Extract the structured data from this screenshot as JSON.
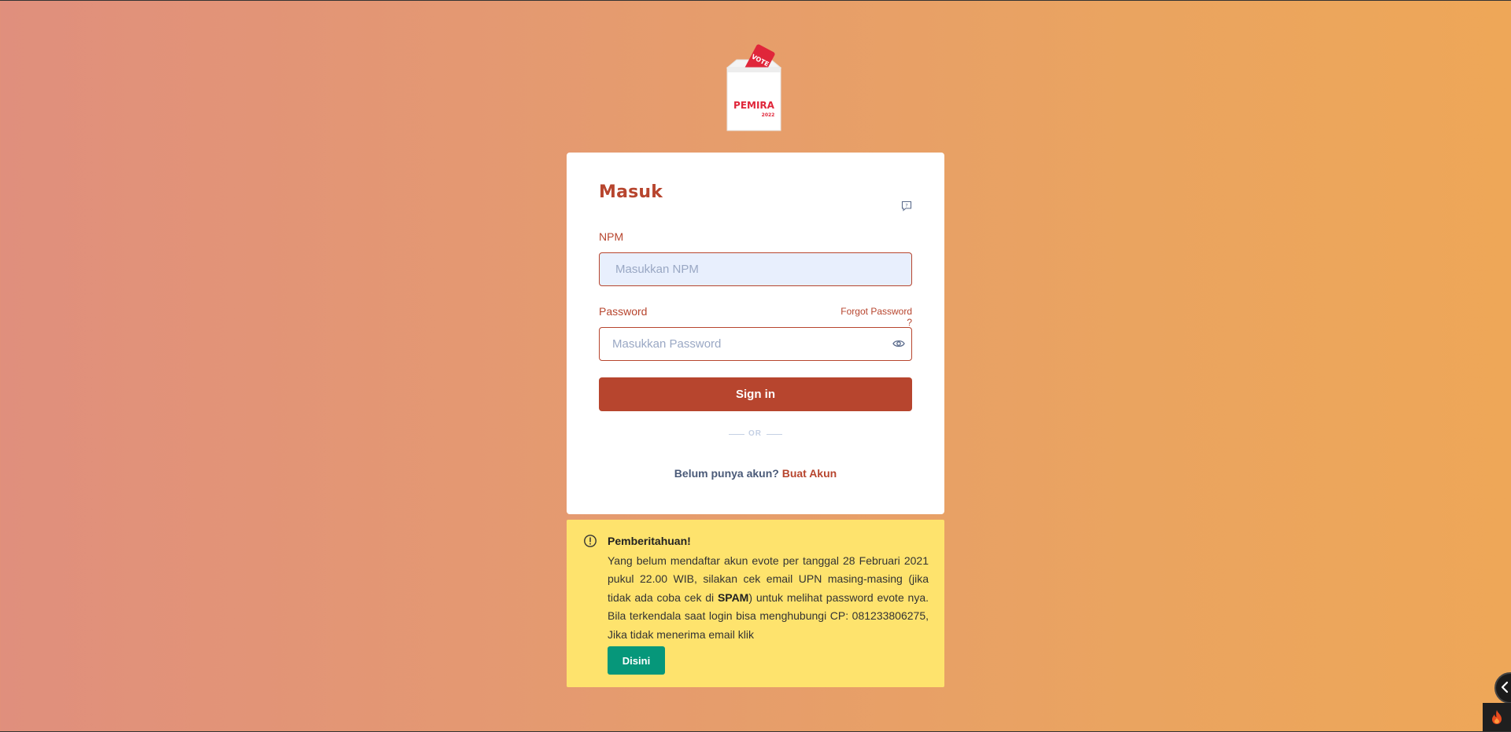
{
  "logo": {
    "brand_text": "PEMIRA",
    "year_text": "2022",
    "ballot_text": "VOTE"
  },
  "login": {
    "title": "Masuk",
    "help_icon": "help-chat-icon",
    "npm_label": "NPM",
    "npm_placeholder": "Masukkan NPM",
    "npm_value": "",
    "password_label": "Password",
    "forgot_label": "Forgot Password ?",
    "password_placeholder": "Masukkan Password",
    "password_value": "",
    "eye_icon": "eye-icon",
    "signin_label": "Sign in",
    "divider_label": "OR",
    "signup_prompt": "Belum punya akun?",
    "signup_link": "Buat Akun"
  },
  "notice": {
    "icon": "alert-circle-icon",
    "title": "Pemberitahuan!",
    "text_part1": "Yang belum mendaftar akun evote per tanggal 28 Februari 2021 pukul 22.00 WIB, silakan cek email UPN masing-masing (jika tidak ada coba cek di ",
    "text_bold": "SPAM",
    "text_part2": ") untuk melihat password evote nya. Bila terkendala saat login bisa menghubungi CP: 081233806275, Jika tidak menerima email klik",
    "button_label": "Disini"
  },
  "colors": {
    "primary": "#b7452e",
    "notice_bg": "#fee36d",
    "button_green": "#06977a",
    "npm_input_bg": "#e8effd"
  },
  "widgets": {
    "side_toggle_icon": "chevron-left-icon",
    "corner_icon": "flame-icon"
  }
}
